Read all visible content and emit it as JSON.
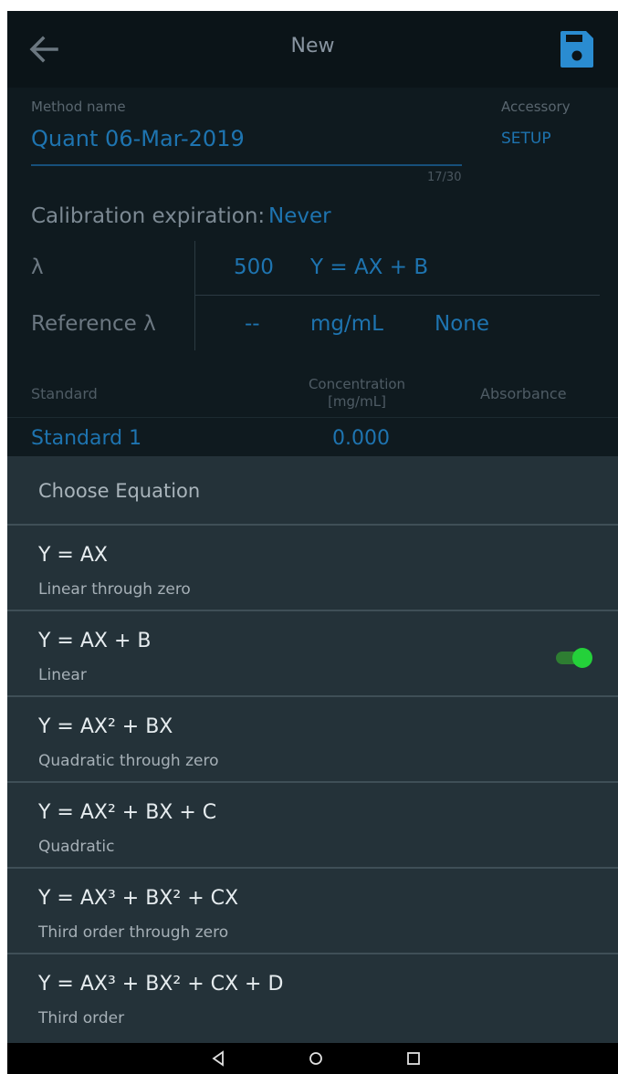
{
  "appbar": {
    "title": "New",
    "back_icon": "arrow-left-icon",
    "save_icon": "floppy-save-icon",
    "accent": "#2a8cd1"
  },
  "form": {
    "method_name_label": "Method name",
    "method_name_value": "Quant 06-Mar-2019",
    "char_count": "17/30",
    "accessory_label": "Accessory",
    "accessory_action": "SETUP",
    "calibration_label": "Calibration expiration:",
    "calibration_value": "Never",
    "lambda": {
      "label": "λ",
      "value": "500",
      "equation": "Y = AX + B"
    },
    "reference": {
      "label": "Reference λ",
      "value": "--",
      "unit": "mg/mL",
      "option": "None"
    }
  },
  "table": {
    "headers": {
      "standard": "Standard",
      "concentration_line1": "Concentration",
      "concentration_line2": "[mg/mL]",
      "absorbance": "Absorbance"
    },
    "rows": [
      {
        "name": "Standard 1",
        "concentration": "0.000",
        "absorbance": ""
      }
    ]
  },
  "sheet": {
    "title": "Choose Equation",
    "options": [
      {
        "equation": "Y = AX",
        "description": "Linear through zero",
        "selected": false
      },
      {
        "equation": "Y = AX + B",
        "description": "Linear",
        "selected": true
      },
      {
        "equation": "Y = AX² + BX",
        "description": "Quadratic through zero",
        "selected": false
      },
      {
        "equation": "Y = AX² + BX + C",
        "description": "Quadratic",
        "selected": false
      },
      {
        "equation": "Y = AX³ + BX² + CX",
        "description": "Third order through zero",
        "selected": false
      },
      {
        "equation": "Y = AX³ + BX² + CX + D",
        "description": "Third order",
        "selected": false
      }
    ],
    "toggle_color": "#24d13a"
  },
  "navbar": {
    "buttons": [
      "back-triangle-icon",
      "home-circle-icon",
      "recents-square-icon"
    ]
  }
}
